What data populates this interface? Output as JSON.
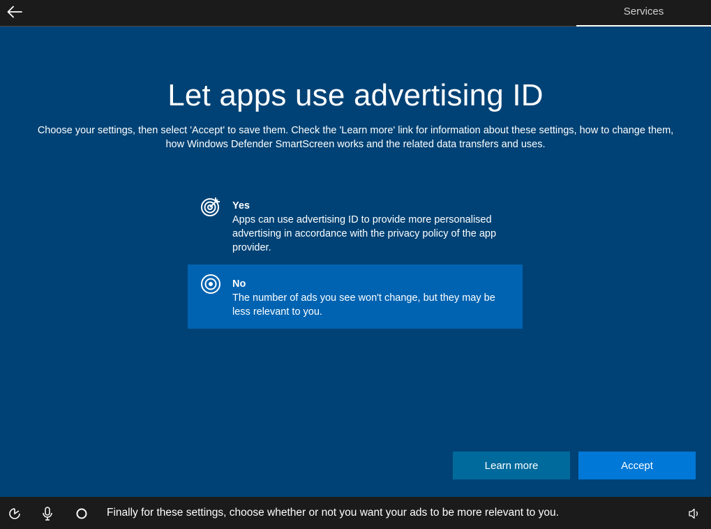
{
  "topbar": {
    "back_icon": "back-arrow-icon",
    "current_step": "Services"
  },
  "page": {
    "title": "Let apps use advertising ID",
    "subtitle": "Choose your settings, then select 'Accept' to save them. Check the 'Learn more' link for information about these settings, how to change them, how Windows Defender SmartScreen works and the related data transfers and uses."
  },
  "options": [
    {
      "title": "Yes",
      "description": "Apps can use advertising ID to provide more personalised advertising in accordance with the privacy policy of the app provider.",
      "icon": "target-with-arrow-icon",
      "selected": false
    },
    {
      "title": "No",
      "description": "The number of ads you see won't change, but they may be less relevant to you.",
      "icon": "target-icon",
      "selected": true
    }
  ],
  "buttons": {
    "learn_more": "Learn more",
    "accept": "Accept"
  },
  "bottombar": {
    "ease_of_access_icon": "ease-of-access-icon",
    "microphone_icon": "microphone-icon",
    "cortana_icon": "cortana-circle-icon",
    "narrator_text": "Finally for these settings, choose whether or not you want your ads to be more relevant to you.",
    "volume_icon": "volume-icon"
  },
  "colors": {
    "background": "#004275",
    "selected_option": "#0063b1",
    "learn_more_button": "#006a9c",
    "accept_button": "#0078d7",
    "bars": "#1b1b1b"
  }
}
